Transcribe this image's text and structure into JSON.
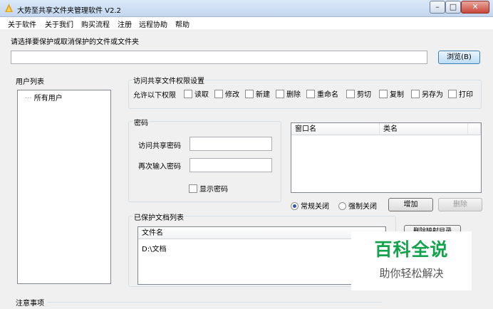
{
  "window": {
    "title": "大势至共享文件夹管理软件 V2.2"
  },
  "menu": [
    "关于软件",
    "关于我们",
    "购买流程",
    "注册",
    "远程协助",
    "帮助"
  ],
  "path": {
    "label": "请选择要保护或取消保护的文件或文件夹",
    "value": "",
    "browse_label": "浏览(B)"
  },
  "users": {
    "label": "用户列表",
    "items": [
      "所有用户"
    ]
  },
  "permissions": {
    "label": "访问共享文件权限设置",
    "allow_label": "允许以下权限",
    "options": [
      "读取",
      "修改",
      "新建",
      "删除",
      "重命名",
      "剪切",
      "复制",
      "另存为",
      "打印"
    ]
  },
  "password": {
    "label": "密码",
    "access_label": "访问共享密码",
    "confirm_label": "再次输入密码",
    "show_label": "显示密码"
  },
  "window_table": {
    "columns": [
      "窗口名",
      "类名"
    ]
  },
  "close_mode": {
    "options": [
      "常规关闭",
      "强制关闭"
    ],
    "selected": "常规关闭"
  },
  "actions": {
    "add_label": "增加",
    "delete_label": "删除",
    "delete_map_label": "删除映射目录"
  },
  "protected": {
    "label": "已保护文档列表",
    "column": "文件名",
    "items": [
      "D:\\文档"
    ]
  },
  "notes": {
    "label": "注意事项"
  },
  "watermark": {
    "line1": "百科全说",
    "line2": "助你轻松解决"
  }
}
